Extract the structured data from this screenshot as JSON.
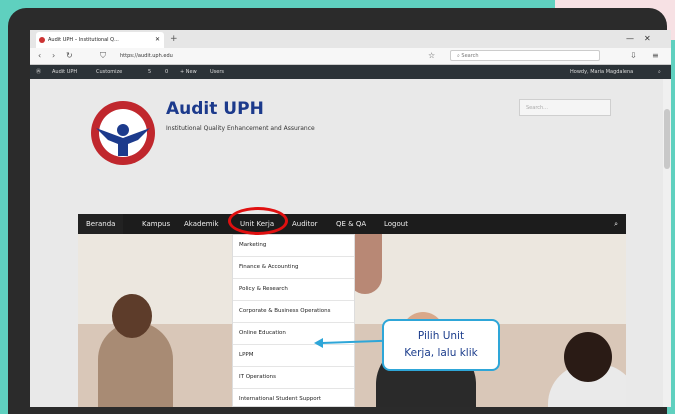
{
  "browser": {
    "tab_title": "Audit UPH – Institutional Q...",
    "new_tab": "+",
    "url": "https://audit.uph.edu",
    "search_placeholder": "Search",
    "window_controls": [
      "—",
      "☐",
      "✕"
    ]
  },
  "wp_admin_bar": {
    "items": [
      "Audit UPH",
      "Customize",
      "5",
      "0",
      "+ New",
      "Users"
    ],
    "greeting": "Howdy, Maria Magdalena"
  },
  "site": {
    "title": "Audit UPH",
    "tagline": "Institutional Quality Enhancement and Assurance",
    "search_placeholder": "Search..."
  },
  "main_nav": [
    "Beranda",
    "Kampus",
    "Akademik",
    "Unit Kerja",
    "Auditor",
    "QE & QA",
    "Logout"
  ],
  "dropdown": [
    "Marketing",
    "Finance & Accounting",
    "Policy & Research",
    "Corporate & Business Operations",
    "Online Education",
    "LPPM",
    "IT Operations",
    "International Student Support"
  ],
  "annotation": {
    "callout_line1": "Pilih Unit",
    "callout_line2": "Kerja, lalu klik",
    "highlight_color": "#e01010",
    "callout_color": "#2ea6d8"
  }
}
